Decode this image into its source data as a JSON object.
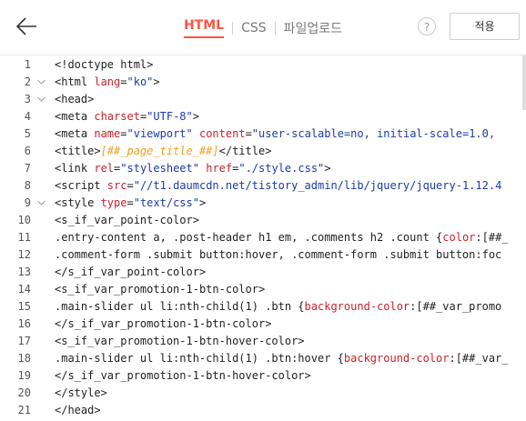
{
  "header": {
    "tabs": [
      {
        "label": "HTML",
        "active": true
      },
      {
        "label": "CSS",
        "active": false
      },
      {
        "label": "파일업로드",
        "active": false
      }
    ],
    "help_label": "?",
    "apply_label": "적용",
    "accent_color": "#ff5544"
  },
  "editor": {
    "lines": [
      {
        "num": "1",
        "fold": false,
        "segs": [
          {
            "t": "<!doctype html>",
            "c": ""
          }
        ]
      },
      {
        "num": "2",
        "fold": true,
        "segs": [
          {
            "t": "<html ",
            "c": ""
          },
          {
            "t": "lang",
            "c": "attr"
          },
          {
            "t": "=",
            "c": ""
          },
          {
            "t": "\"ko\"",
            "c": "str"
          },
          {
            "t": ">",
            "c": ""
          }
        ]
      },
      {
        "num": "3",
        "fold": true,
        "segs": [
          {
            "t": "<head>",
            "c": ""
          }
        ]
      },
      {
        "num": "4",
        "fold": false,
        "segs": [
          {
            "t": "<meta ",
            "c": ""
          },
          {
            "t": "charset",
            "c": "attr"
          },
          {
            "t": "=",
            "c": ""
          },
          {
            "t": "\"UTF-8\"",
            "c": "str"
          },
          {
            "t": ">",
            "c": ""
          }
        ]
      },
      {
        "num": "5",
        "fold": false,
        "segs": [
          {
            "t": "<meta ",
            "c": ""
          },
          {
            "t": "name",
            "c": "attr"
          },
          {
            "t": "=",
            "c": ""
          },
          {
            "t": "\"viewport\"",
            "c": "str"
          },
          {
            "t": " ",
            "c": ""
          },
          {
            "t": "content",
            "c": "attr"
          },
          {
            "t": "=",
            "c": ""
          },
          {
            "t": "\"user-scalable=no, initial-scale=1.0, ",
            "c": "str"
          }
        ]
      },
      {
        "num": "6",
        "fold": false,
        "segs": [
          {
            "t": "<title>",
            "c": ""
          },
          {
            "t": "[##_page_title_##]",
            "c": "tpl"
          },
          {
            "t": "</title>",
            "c": ""
          }
        ]
      },
      {
        "num": "7",
        "fold": false,
        "segs": [
          {
            "t": "<link ",
            "c": ""
          },
          {
            "t": "rel",
            "c": "attr"
          },
          {
            "t": "=",
            "c": ""
          },
          {
            "t": "\"stylesheet\"",
            "c": "str"
          },
          {
            "t": " ",
            "c": ""
          },
          {
            "t": "href",
            "c": "attr"
          },
          {
            "t": "=",
            "c": ""
          },
          {
            "t": "\"./style.css\"",
            "c": "str"
          },
          {
            "t": ">",
            "c": ""
          }
        ]
      },
      {
        "num": "8",
        "fold": false,
        "segs": [
          {
            "t": "<script ",
            "c": ""
          },
          {
            "t": "src",
            "c": "attr"
          },
          {
            "t": "=",
            "c": ""
          },
          {
            "t": "\"//t1.daumcdn.net/tistory_admin/lib/jquery/jquery-1.12.4",
            "c": "str"
          }
        ]
      },
      {
        "num": "9",
        "fold": true,
        "segs": [
          {
            "t": "<style ",
            "c": ""
          },
          {
            "t": "type",
            "c": "attr"
          },
          {
            "t": "=",
            "c": ""
          },
          {
            "t": "\"text/css\"",
            "c": "str"
          },
          {
            "t": ">",
            "c": ""
          }
        ]
      },
      {
        "num": "10",
        "fold": false,
        "segs": [
          {
            "t": "<s_if_var_point-color>",
            "c": ""
          }
        ]
      },
      {
        "num": "11",
        "fold": false,
        "segs": [
          {
            "t": ".entry-content a, .post-header h1 em, .comments h2 .count {",
            "c": ""
          },
          {
            "t": "color",
            "c": "attr"
          },
          {
            "t": ":[##_",
            "c": ""
          }
        ]
      },
      {
        "num": "12",
        "fold": false,
        "segs": [
          {
            "t": ".comment-form .submit button:hover, .comment-form .submit button:foc",
            "c": ""
          }
        ]
      },
      {
        "num": "13",
        "fold": false,
        "segs": [
          {
            "t": "</s_if_var_point-color>",
            "c": ""
          }
        ]
      },
      {
        "num": "14",
        "fold": false,
        "segs": [
          {
            "t": "<s_if_var_promotion-1-btn-color>",
            "c": ""
          }
        ]
      },
      {
        "num": "15",
        "fold": false,
        "segs": [
          {
            "t": ".main-slider ul li:nth-child(1) .btn {",
            "c": ""
          },
          {
            "t": "background-color",
            "c": "attr"
          },
          {
            "t": ":[##_var_promo",
            "c": ""
          }
        ]
      },
      {
        "num": "16",
        "fold": false,
        "segs": [
          {
            "t": "</s_if_var_promotion-1-btn-color>",
            "c": ""
          }
        ]
      },
      {
        "num": "17",
        "fold": false,
        "segs": [
          {
            "t": "<s_if_var_promotion-1-btn-hover-color>",
            "c": ""
          }
        ]
      },
      {
        "num": "18",
        "fold": false,
        "segs": [
          {
            "t": ".main-slider ul li:nth-child(1) .btn:hover {",
            "c": ""
          },
          {
            "t": "background-color",
            "c": "attr"
          },
          {
            "t": ":[##_var_",
            "c": ""
          }
        ]
      },
      {
        "num": "19",
        "fold": false,
        "segs": [
          {
            "t": "</s_if_var_promotion-1-btn-hover-color>",
            "c": ""
          }
        ]
      },
      {
        "num": "20",
        "fold": false,
        "segs": [
          {
            "t": "</style>",
            "c": ""
          }
        ]
      },
      {
        "num": "21",
        "fold": false,
        "segs": [
          {
            "t": "</head>",
            "c": ""
          }
        ]
      }
    ]
  }
}
